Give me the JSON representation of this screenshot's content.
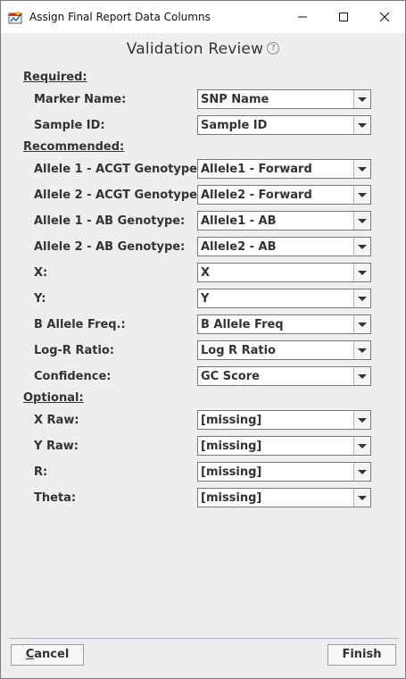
{
  "window": {
    "title": "Assign Final Report Data Columns",
    "controls": {
      "minimize": "─",
      "maximize": "☐",
      "close": "✕"
    }
  },
  "dialog": {
    "title": "Validation Review",
    "help_glyph": "?"
  },
  "sections": {
    "required": "Required:",
    "recommended": "Recommended:",
    "optional": "Optional:"
  },
  "fields": [
    {
      "label": "Marker Name:",
      "value": "SNP Name"
    },
    {
      "label": "Sample ID:",
      "value": "Sample ID"
    },
    {
      "label": "Allele 1 - ACGT Genotype:",
      "value": "Allele1 - Forward"
    },
    {
      "label": "Allele 2 - ACGT Genotype:",
      "value": "Allele2 - Forward"
    },
    {
      "label": "Allele 1 - AB Genotype:",
      "value": "Allele1 - AB"
    },
    {
      "label": "Allele 2 - AB Genotype:",
      "value": "Allele2 - AB"
    },
    {
      "label": "X:",
      "value": "X"
    },
    {
      "label": "Y:",
      "value": "Y"
    },
    {
      "label": "B Allele Freq.:",
      "value": "B Allele Freq"
    },
    {
      "label": "Log-R Ratio:",
      "value": "Log R Ratio"
    },
    {
      "label": "Confidence:",
      "value": "GC Score"
    },
    {
      "label": "X Raw:",
      "value": "[missing]"
    },
    {
      "label": "Y Raw:",
      "value": "[missing]"
    },
    {
      "label": "R:",
      "value": "[missing]"
    },
    {
      "label": "Theta:",
      "value": "[missing]"
    }
  ],
  "buttons": {
    "cancel_mnemonic": "C",
    "cancel_rest": "ancel",
    "finish": "Finish"
  }
}
